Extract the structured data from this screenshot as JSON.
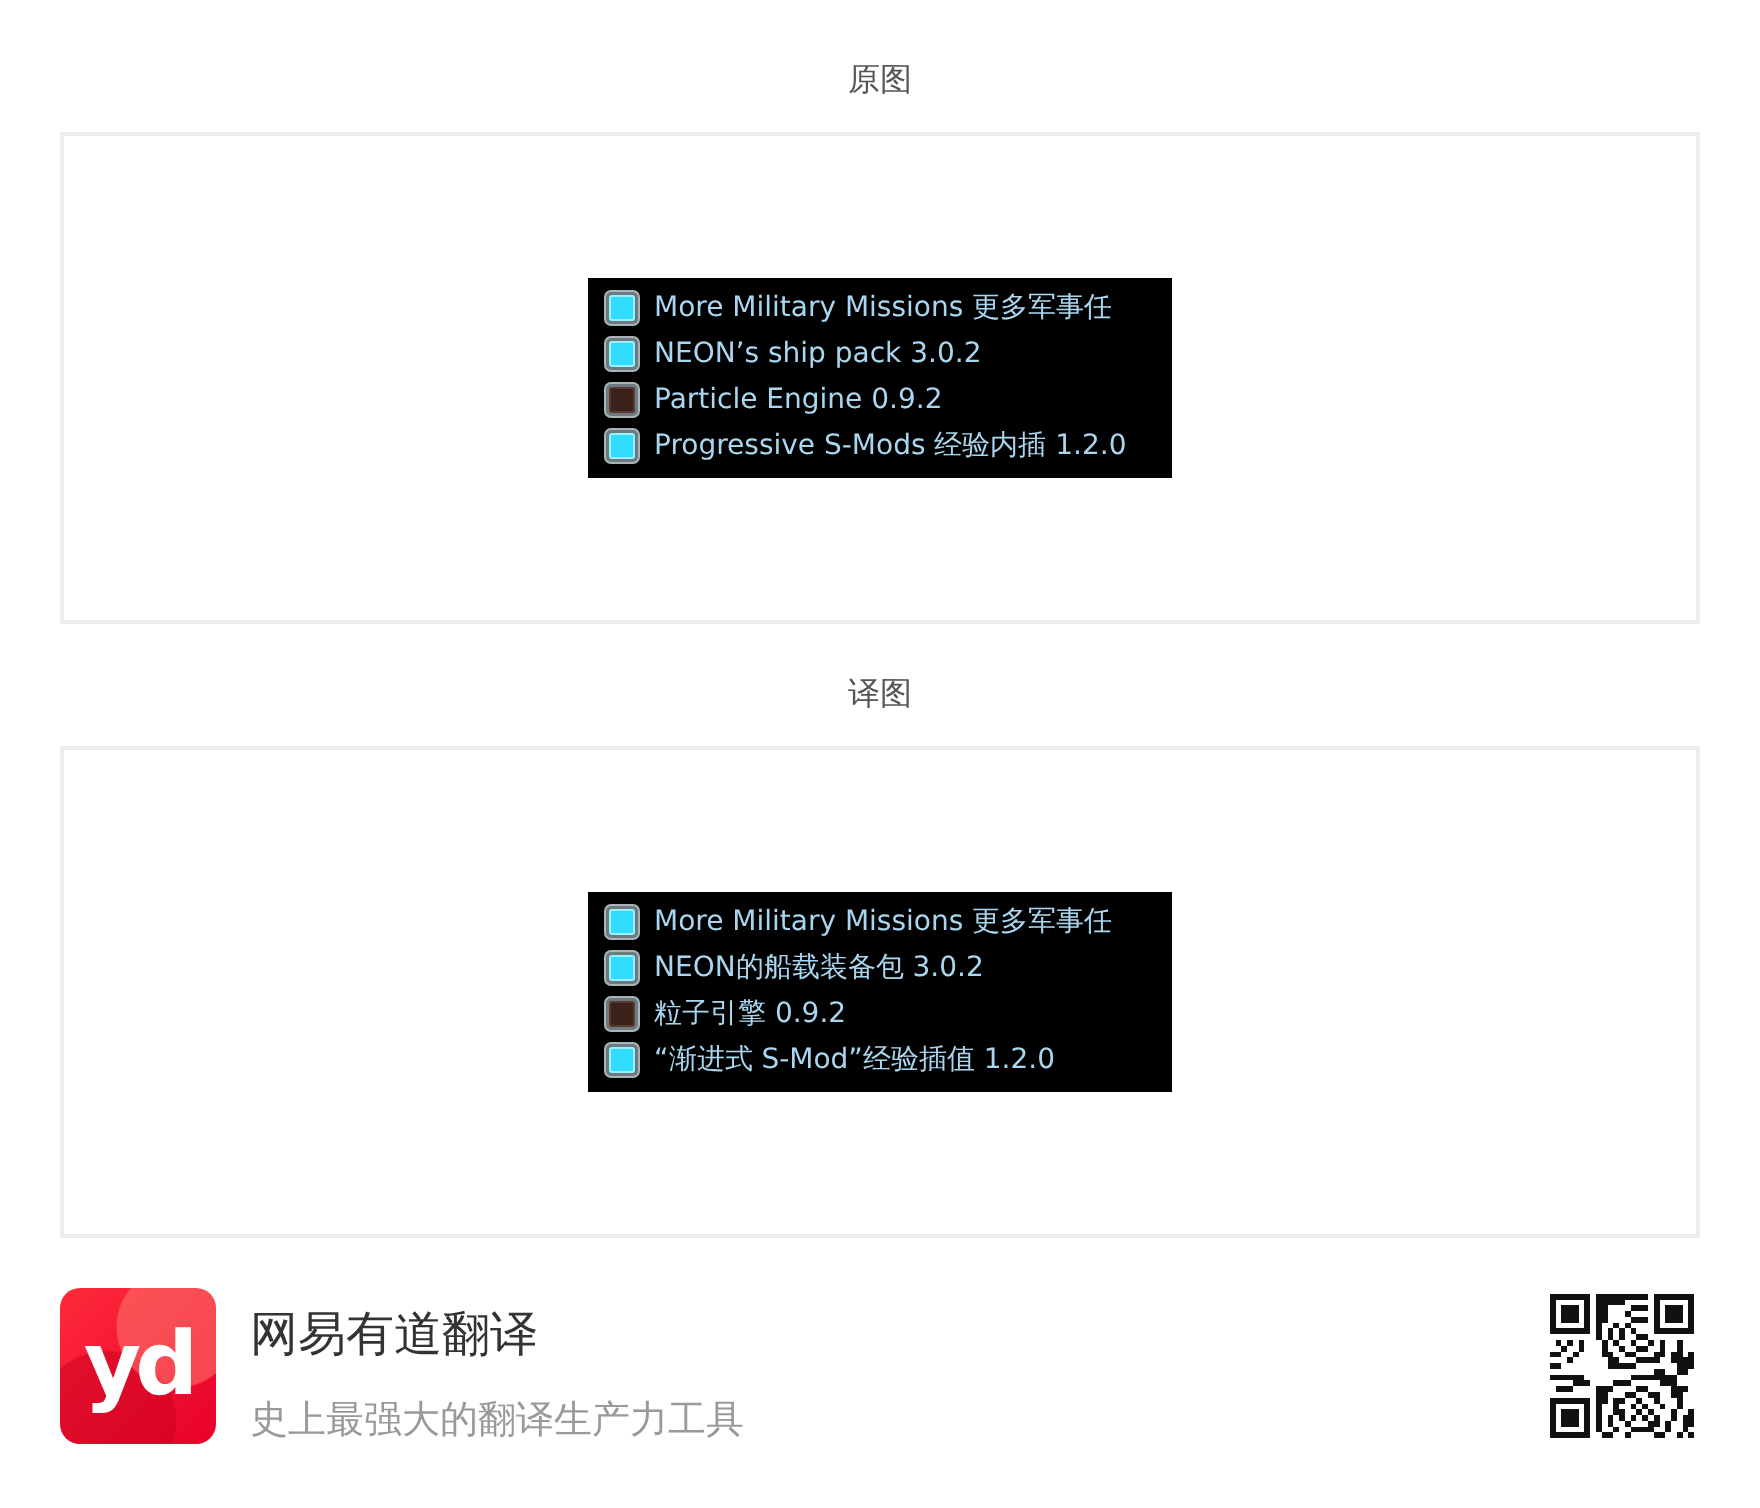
{
  "sections": [
    {
      "heading": "原图",
      "screenshot": {
        "rows": [
          {
            "checked": true,
            "text": "More Military Missions 更多军事任"
          },
          {
            "checked": true,
            "text": "NEON’s ship pack 3.0.2"
          },
          {
            "checked": false,
            "text": "Particle Engine 0.9.2"
          },
          {
            "checked": true,
            "text": "Progressive S-Mods 经验内插 1.2.0"
          }
        ]
      }
    },
    {
      "heading": "译图",
      "screenshot": {
        "rows": [
          {
            "checked": true,
            "text": "More Military Missions 更多军事任"
          },
          {
            "checked": true,
            "text": "NEON的船载装备包 3.0.2"
          },
          {
            "checked": false,
            "text": "粒子引擎 0.9.2"
          },
          {
            "checked": true,
            "text": "“渐进式 S-Mod”经验插值 1.2.0"
          }
        ]
      }
    }
  ],
  "footer": {
    "logo": {
      "text": "yd"
    },
    "app_name": "网易有道翻译",
    "tagline": "史上最强大的翻译生产力工具"
  }
}
